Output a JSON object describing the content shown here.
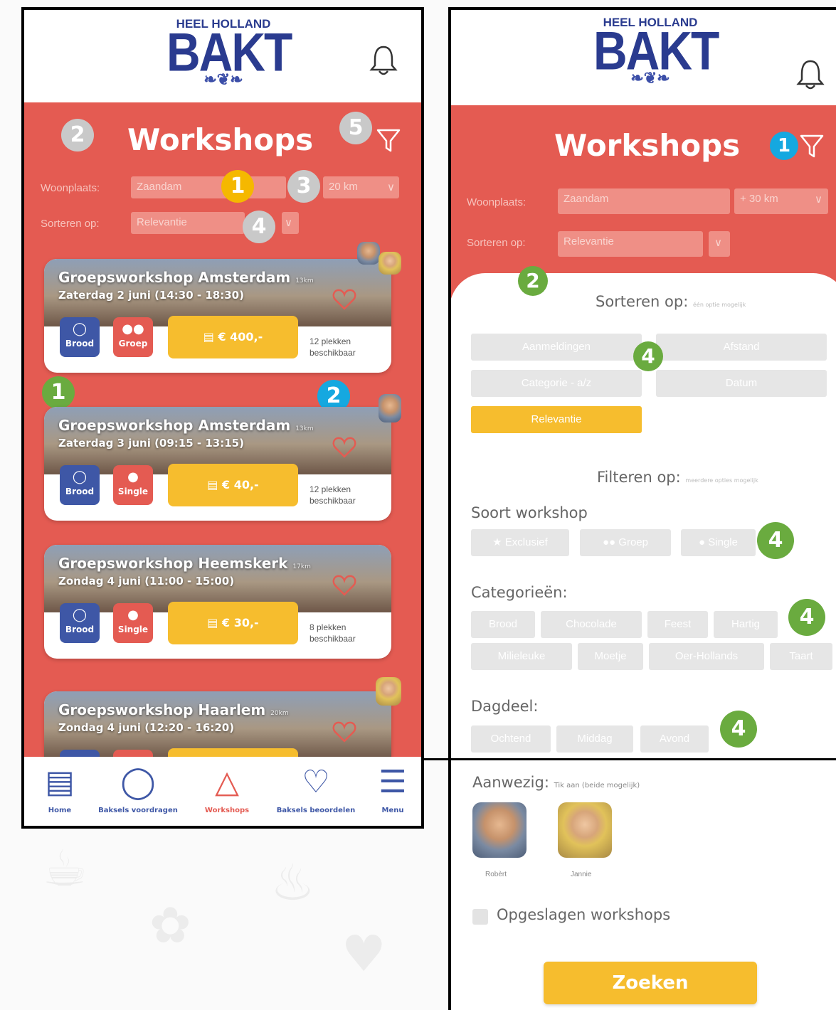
{
  "logo": {
    "line1": "HEEL HOLLAND",
    "line2": "BAKT"
  },
  "left": {
    "title": "Workshops",
    "location_label": "Woonplaats:",
    "location_value": "Zaandam",
    "distance_value": "20 km",
    "sort_label": "Sorteren op:",
    "sort_value": "Relevantie",
    "badges": {
      "b1": "1",
      "b2": "2",
      "b3": "3",
      "b4": "4",
      "b5": "5",
      "g1": "1",
      "c2": "2"
    },
    "cards": [
      {
        "title": "Groepsworkshop Amsterdam",
        "dist": "13km",
        "date": "Zaterdag 2 juni (14:30 - 18:30)",
        "tag1": "Brood",
        "tag2": "Groep",
        "price": "€ 400,-",
        "spots1": "12 plekken",
        "spots2": "beschikbaar"
      },
      {
        "title": "Groepsworkshop Amsterdam",
        "dist": "13km",
        "date": "Zaterdag 3 juni (09:15 - 13:15)",
        "tag1": "Brood",
        "tag2": "Single",
        "price": "€ 40,-",
        "spots1": "12 plekken",
        "spots2": "beschikbaar"
      },
      {
        "title": "Groepsworkshop Heemskerk",
        "dist": "17km",
        "date": "Zondag 4 juni (11:00 - 15:00)",
        "tag1": "Brood",
        "tag2": "Single",
        "price": "€ 30,-",
        "spots1": "8 plekken",
        "spots2": "beschikbaar"
      },
      {
        "title": "Groepsworkshop Haarlem",
        "dist": "20km",
        "date": "Zondag 4 juni (12:20 - 16:20)"
      }
    ],
    "nav": [
      "Home",
      "Baksels voordragen",
      "Workshops",
      "Baksels beoordelen",
      "Menu"
    ],
    "nav_active": "Workshops"
  },
  "right": {
    "title": "Workshops",
    "location_label": "Woonplaats:",
    "location_value": "Zaandam",
    "distance_value": "+ 30 km",
    "sort_label": "Sorteren op:",
    "sort_value": "Relevantie",
    "badges": {
      "c1": "1",
      "g2": "2",
      "g4a": "4",
      "g4b": "4",
      "g4c": "4",
      "g4d": "4"
    },
    "sort_heading": "Sorteren op:",
    "sort_hint": "één optie mogelijk",
    "sort_options": [
      "Aanmeldingen",
      "Afstand",
      "Categorie - a/z",
      "Datum",
      "Relevantie"
    ],
    "sort_selected": "Relevantie",
    "filter_heading": "Filteren op:",
    "filter_hint": "meerdere opties mogelijk",
    "type_label": "Soort workshop",
    "type_options": [
      "Exclusief",
      "Groep",
      "Single"
    ],
    "cat_label": "Categorieën:",
    "cat_options": [
      "Brood",
      "Chocolade",
      "Feest",
      "Hartig",
      "Milieleuke",
      "Moetje",
      "Oer-Hollands",
      "Taart"
    ],
    "daypart_label": "Dagdeel:",
    "daypart_options": [
      "Ochtend",
      "Middag",
      "Avond"
    ],
    "present_label": "Aanwezig:",
    "present_hint": "Tik aan (beide mogelijk)",
    "people": [
      "Robèrt",
      "Jannie"
    ],
    "saved_label": "Opgeslagen workshops",
    "search_button": "Zoeken"
  }
}
